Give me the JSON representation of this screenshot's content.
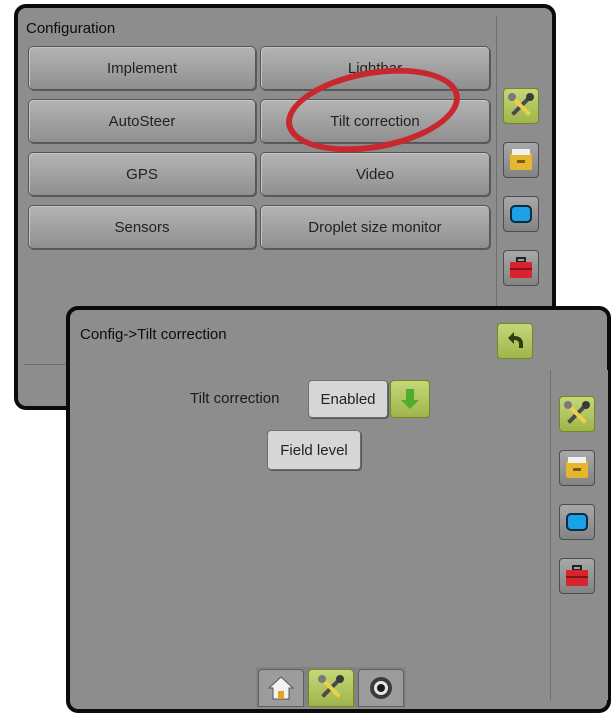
{
  "back_screen": {
    "title": "Configuration",
    "buttons": [
      "Implement",
      "Lightbar",
      "AutoSteer",
      "Tilt correction",
      "GPS",
      "Video",
      "Sensors",
      "Droplet size monitor"
    ]
  },
  "front_screen": {
    "title": "Config->Tilt correction",
    "tilt_label": "Tilt correction",
    "tilt_value": "Enabled",
    "field_level_label": "Field level"
  },
  "sidebar_icons": [
    "tools-icon",
    "folder-icon",
    "display-icon",
    "toolbox-icon"
  ],
  "nav_icons": [
    "home-icon",
    "tools-icon",
    "camera-icon"
  ],
  "colors": {
    "screen_bg": "#8d8d8d",
    "accent_green": "#a8c04f",
    "highlight_red": "#c8282d"
  }
}
